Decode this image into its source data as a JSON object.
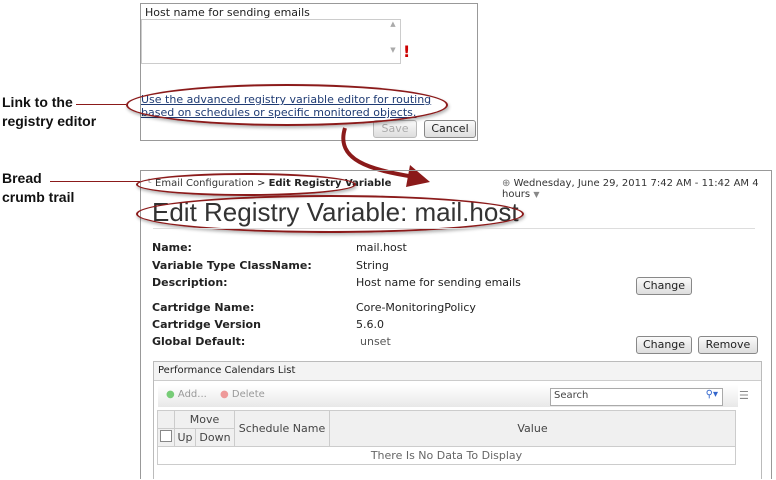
{
  "annotations": {
    "link_line1": "Link to the",
    "link_line2": "registry editor",
    "bc_line1": "Bread",
    "bc_line2": "crumb trail"
  },
  "dialog": {
    "textarea_label": "Host name for sending emails",
    "textarea_value": "",
    "link_text": "Use the advanced registry variable editor for routing based on schedules or specific monitored objects.",
    "save": "Save",
    "cancel": "Cancel"
  },
  "breadcrumb": {
    "parent": "Email Configuration",
    "separator": ">",
    "current": "Edit Registry Variable"
  },
  "time_range": "Wednesday, June 29, 2011 7:42 AM - 11:42 AM 4 hours",
  "title": "Edit Registry Variable: mail.host",
  "fields": [
    {
      "label": "Name:",
      "value": "mail.host"
    },
    {
      "label": "Variable Type ClassName:",
      "value": "String"
    },
    {
      "label": "Description:",
      "value": "Host name for sending emails"
    },
    {
      "label": "Cartridge Name:",
      "value": "Core-MonitoringPolicy"
    },
    {
      "label": "Cartridge Version",
      "value": "5.6.0"
    },
    {
      "label": "Global Default:",
      "value": "unset"
    }
  ],
  "buttons": {
    "change": "Change",
    "remove": "Remove"
  },
  "calendars": {
    "title": "Performance Calendars List",
    "add": "Add...",
    "delete": "Delete",
    "search_placeholder": "Search",
    "headers": {
      "move": "Move",
      "up": "Up",
      "down": "Down",
      "schedule": "Schedule Name",
      "value": "Value"
    },
    "empty": "There Is No Data To Display"
  },
  "colors": {
    "accent": "#8b1a1a"
  }
}
